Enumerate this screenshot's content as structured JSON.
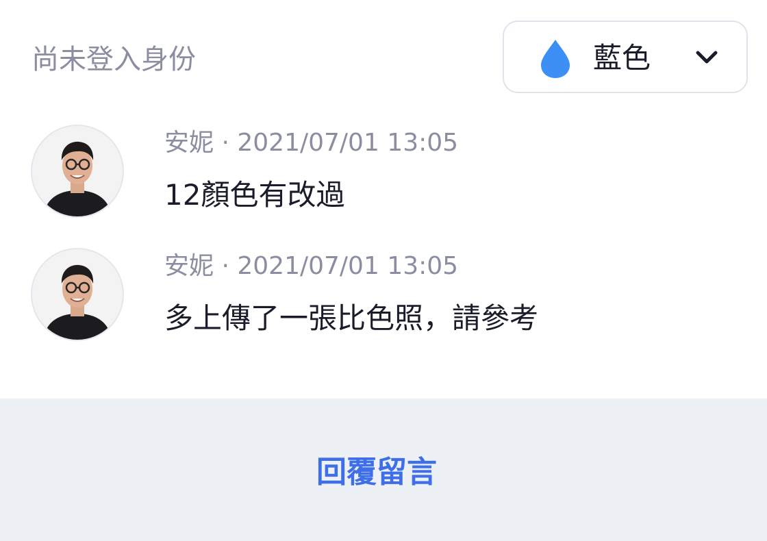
{
  "header": {
    "login_status": "尚未登入身份",
    "color_select": {
      "selected": "藍色",
      "icon": "water-drop-icon",
      "icon_color": "#3b8ff5",
      "expand_icon": "chevron-down-icon"
    }
  },
  "comments": [
    {
      "author": "安妮",
      "separator": "·",
      "timestamp": "2021/07/01 13:05",
      "text": "12顏色有改過",
      "avatar": "avatar-photo"
    },
    {
      "author": "安妮",
      "separator": "·",
      "timestamp": "2021/07/01 13:05",
      "text": "多上傳了一張比色照，請參考",
      "avatar": "avatar-photo"
    }
  ],
  "footer": {
    "reply_label": "回覆留言",
    "accent_color": "#3f6fe8"
  }
}
